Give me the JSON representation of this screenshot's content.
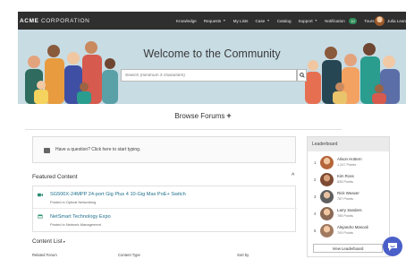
{
  "header": {
    "brand_bold": "ACME",
    "brand_light": "CORPORATION",
    "nav": [
      {
        "label": "Knowledge",
        "dropdown": false
      },
      {
        "label": "Requests",
        "dropdown": true
      },
      {
        "label": "My Lists",
        "dropdown": false
      },
      {
        "label": "Case",
        "dropdown": true
      },
      {
        "label": "Catalog",
        "dropdown": false
      },
      {
        "label": "Support",
        "dropdown": true
      },
      {
        "label": "Notification",
        "dropdown": false
      },
      {
        "label": "Tours",
        "dropdown": false
      }
    ],
    "notification_count": "10",
    "user_name": "Julia Lean"
  },
  "hero": {
    "title": "Welcome to the Community",
    "search_placeholder": "Search (minimum 3 characters)"
  },
  "browse": {
    "label": "Browse Forums",
    "plus": "+"
  },
  "ask": {
    "text": "Have a question? Click here to start typing."
  },
  "featured": {
    "title": "Featured Content",
    "items": [
      {
        "title": "SG500X-24MPP 24-port Gig Plus 4 10-Gig Max PoE+ Switch",
        "subtitle": "Posted in Optical Networking",
        "icon": "video-icon"
      },
      {
        "title": "NetSmart Technology Expo",
        "subtitle": "Posted in Network Management",
        "icon": "calendar-icon"
      }
    ]
  },
  "content_list": {
    "title": "Content List",
    "columns": [
      "Related Forum",
      "Content Type",
      "Sort by"
    ]
  },
  "leaderboard": {
    "title": "Leaderboard",
    "entries": [
      {
        "rank": "1",
        "name": "Alison Hottern",
        "points": "1,247 Points",
        "color": "#b5653a"
      },
      {
        "rank": "2",
        "name": "Kim Ross",
        "points": "835 Points",
        "color": "#7d4a33"
      },
      {
        "rank": "3",
        "name": "Rick Weaver",
        "points": "787 Points",
        "color": "#5e5e5e"
      },
      {
        "rank": "4",
        "name": "Larry Sanders",
        "points": "785 Points",
        "color": "#8a6a55"
      },
      {
        "rank": "5",
        "name": "Alejandro Mascali",
        "points": "700 Points",
        "color": "#a07a60"
      }
    ],
    "button_label": "View Leaderboard"
  }
}
